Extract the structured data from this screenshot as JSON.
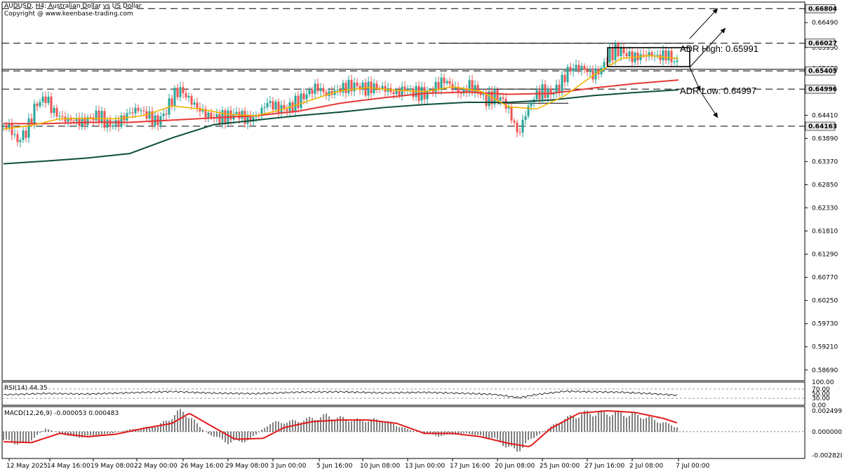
{
  "header": {
    "symbol_line": "AUDUSD, H4:  Australian Dollar vs US Dollar",
    "copyright": "Copyright @ www.keenbase-trading.com"
  },
  "colors": {
    "bull": "#26a69a",
    "bear": "#ef5350",
    "ma_fast": "#f4b400",
    "ma_mid": "#e53935",
    "ma_slow": "#0d4f3c",
    "macd_signal": "#e31b1b",
    "level_tag": "#e8e8e8"
  },
  "chart_data": [
    {
      "type": "candlestick",
      "title": "AUDUSD, H4",
      "ylim": [
        0.5845,
        0.6695
      ],
      "y_ticks": [
        "0.66490",
        "0.65930",
        "0.65460",
        "0.64410",
        "0.63890",
        "0.63370",
        "0.62850",
        "0.62330",
        "0.61810",
        "0.61290",
        "0.60770",
        "0.60250",
        "0.59730",
        "0.59210",
        "0.58690"
      ],
      "x_ticks": [
        "12 May 2025",
        "14 May 16:00",
        "19 May 08:00",
        "22 May 00:00",
        "26 May 16:00",
        "29 May 08:00",
        "3 Jun 00:00",
        "5 Jun 16:00",
        "10 Jun 08:00",
        "13 Jun 00:00",
        "17 Jun 16:00",
        "20 Jun 08:00",
        "25 Jun 00:00",
        "27 Jun 16:00",
        "2 Jul 08:00",
        "7 Jul 00:00"
      ],
      "levels": [
        {
          "value": 0.66804,
          "label": "0.66804",
          "highlight": true
        },
        {
          "value": 0.66027,
          "label": "0.66027",
          "highlight": true
        },
        {
          "value": 0.65405,
          "label": "0.65405",
          "highlight": true
        },
        {
          "value": 0.64996,
          "label": "0.64996",
          "highlight": true
        },
        {
          "value": 0.64163,
          "label": "0.64163",
          "highlight": true
        }
      ],
      "annotations": {
        "adr_high": "ADR High: 0.65991",
        "adr_low": "ADR Low: 0.64997"
      },
      "price_path": [
        [
          0,
          0.6418
        ],
        [
          8,
          0.6415
        ],
        [
          20,
          0.6382
        ],
        [
          34,
          0.6408
        ],
        [
          46,
          0.6465
        ],
        [
          60,
          0.648
        ],
        [
          72,
          0.6448
        ],
        [
          86,
          0.6432
        ],
        [
          100,
          0.643
        ],
        [
          112,
          0.6425
        ],
        [
          124,
          0.6435
        ],
        [
          136,
          0.644
        ],
        [
          150,
          0.6418
        ],
        [
          164,
          0.6425
        ],
        [
          178,
          0.6445
        ],
        [
          192,
          0.6455
        ],
        [
          206,
          0.644
        ],
        [
          218,
          0.6425
        ],
        [
          230,
          0.6445
        ],
        [
          242,
          0.6485
        ],
        [
          252,
          0.6498
        ],
        [
          264,
          0.6478
        ],
        [
          278,
          0.6455
        ],
        [
          292,
          0.644
        ],
        [
          306,
          0.6435
        ],
        [
          320,
          0.6438
        ],
        [
          334,
          0.6445
        ],
        [
          348,
          0.643
        ],
        [
          362,
          0.644
        ],
        [
          376,
          0.647
        ],
        [
          390,
          0.6458
        ],
        [
          404,
          0.6455
        ],
        [
          418,
          0.647
        ],
        [
          432,
          0.6488
        ],
        [
          446,
          0.6505
        ],
        [
          460,
          0.6488
        ],
        [
          474,
          0.6495
        ],
        [
          488,
          0.6505
        ],
        [
          502,
          0.6508
        ],
        [
          516,
          0.65
        ],
        [
          530,
          0.6505
        ],
        [
          544,
          0.65
        ],
        [
          558,
          0.649
        ],
        [
          572,
          0.65
        ],
        [
          586,
          0.6492
        ],
        [
          600,
          0.6488
        ],
        [
          614,
          0.6502
        ],
        [
          628,
          0.652
        ],
        [
          640,
          0.6505
        ],
        [
          652,
          0.649
        ],
        [
          664,
          0.6508
        ],
        [
          676,
          0.6495
        ],
        [
          688,
          0.6475
        ],
        [
          700,
          0.6485
        ],
        [
          712,
          0.6475
        ],
        [
          722,
          0.6445
        ],
        [
          734,
          0.6395
        ],
        [
          744,
          0.6445
        ],
        [
          756,
          0.6482
        ],
        [
          768,
          0.6495
        ],
        [
          780,
          0.649
        ],
        [
          792,
          0.6505
        ],
        [
          804,
          0.654
        ],
        [
          816,
          0.655
        ],
        [
          828,
          0.6545
        ],
        [
          840,
          0.653
        ],
        [
          852,
          0.6545
        ],
        [
          862,
          0.6575
        ],
        [
          874,
          0.6588
        ],
        [
          886,
          0.658
        ],
        [
          898,
          0.657
        ],
        [
          910,
          0.6575
        ],
        [
          922,
          0.6578
        ],
        [
          934,
          0.6572
        ],
        [
          946,
          0.6578
        ],
        [
          956,
          0.656
        ],
        [
          962,
          0.6558
        ]
      ],
      "ma_fast": [
        [
          0,
          0.641
        ],
        [
          40,
          0.6418
        ],
        [
          80,
          0.6433
        ],
        [
          120,
          0.6434
        ],
        [
          160,
          0.6433
        ],
        [
          200,
          0.644
        ],
        [
          240,
          0.6462
        ],
        [
          280,
          0.6455
        ],
        [
          320,
          0.6443
        ],
        [
          360,
          0.644
        ],
        [
          400,
          0.6455
        ],
        [
          440,
          0.6476
        ],
        [
          480,
          0.6496
        ],
        [
          520,
          0.6503
        ],
        [
          560,
          0.6497
        ],
        [
          600,
          0.6494
        ],
        [
          640,
          0.6505
        ],
        [
          680,
          0.6495
        ],
        [
          720,
          0.646
        ],
        [
          760,
          0.6455
        ],
        [
          800,
          0.6485
        ],
        [
          840,
          0.653
        ],
        [
          880,
          0.6568
        ],
        [
          920,
          0.6575
        ],
        [
          962,
          0.6568
        ]
      ],
      "ma_mid": [
        [
          0,
          0.6422
        ],
        [
          60,
          0.6422
        ],
        [
          120,
          0.6425
        ],
        [
          180,
          0.6425
        ],
        [
          240,
          0.643
        ],
        [
          300,
          0.6435
        ],
        [
          360,
          0.644
        ],
        [
          420,
          0.645
        ],
        [
          480,
          0.6468
        ],
        [
          540,
          0.648
        ],
        [
          600,
          0.649
        ],
        [
          660,
          0.6493
        ],
        [
          720,
          0.6488
        ],
        [
          780,
          0.649
        ],
        [
          840,
          0.6502
        ],
        [
          900,
          0.6512
        ],
        [
          962,
          0.652
        ]
      ],
      "ma_slow": [
        [
          0,
          0.6332
        ],
        [
          60,
          0.6338
        ],
        [
          120,
          0.6345
        ],
        [
          180,
          0.6355
        ],
        [
          240,
          0.639
        ],
        [
          300,
          0.642
        ],
        [
          360,
          0.643
        ],
        [
          420,
          0.644
        ],
        [
          480,
          0.6448
        ],
        [
          540,
          0.6458
        ],
        [
          600,
          0.6465
        ],
        [
          660,
          0.647
        ],
        [
          720,
          0.647
        ],
        [
          780,
          0.6475
        ],
        [
          840,
          0.6485
        ],
        [
          900,
          0.6492
        ],
        [
          962,
          0.6498
        ]
      ]
    },
    {
      "type": "line",
      "title": "RSI(14) 44.35",
      "ylim": [
        0,
        100
      ],
      "y_ticks": [
        "100.00",
        "70.00",
        "50.00",
        "30.00",
        "0.00"
      ],
      "x": [
        0,
        60,
        120,
        180,
        240,
        300,
        360,
        420,
        480,
        540,
        600,
        660,
        700,
        735,
        760,
        800,
        840,
        880,
        920,
        962
      ],
      "values": [
        45,
        50,
        47,
        52,
        57,
        50,
        48,
        55,
        57,
        53,
        56,
        52,
        48,
        34,
        48,
        62,
        60,
        58,
        52,
        44.35
      ]
    },
    {
      "type": "bar",
      "title": "MACD(12,26,9) -0.000053 0.000483",
      "ylim": [
        -0.0032,
        0.003
      ],
      "y_ticks": [
        "0.002499",
        "0.000000",
        "-0.002828"
      ],
      "histogram": [
        [
          0,
          -0.0012
        ],
        [
          30,
          -0.0018
        ],
        [
          60,
          0.0004
        ],
        [
          100,
          -0.0008
        ],
        [
          140,
          -0.0005
        ],
        [
          180,
          0.0003
        ],
        [
          220,
          0.0008
        ],
        [
          255,
          0.003
        ],
        [
          290,
          -0.0002
        ],
        [
          320,
          -0.0015
        ],
        [
          350,
          -0.0012
        ],
        [
          380,
          0.0012
        ],
        [
          420,
          0.0015
        ],
        [
          460,
          0.0022
        ],
        [
          500,
          0.0016
        ],
        [
          540,
          0.0016
        ],
        [
          580,
          0.0002
        ],
        [
          620,
          -0.0006
        ],
        [
          660,
          -0.0002
        ],
        [
          700,
          -0.001
        ],
        [
          730,
          -0.0028
        ],
        [
          760,
          -0.0005
        ],
        [
          800,
          0.0018
        ],
        [
          830,
          0.0026
        ],
        [
          870,
          0.0026
        ],
        [
          910,
          0.0022
        ],
        [
          962,
          0.0006
        ]
      ],
      "signal": [
        [
          0,
          -0.0012
        ],
        [
          40,
          -0.0013
        ],
        [
          80,
          -0.0002
        ],
        [
          120,
          -0.0006
        ],
        [
          160,
          -0.0003
        ],
        [
          200,
          0.0004
        ],
        [
          240,
          0.001
        ],
        [
          265,
          0.0022
        ],
        [
          300,
          0.0005
        ],
        [
          330,
          -0.0009
        ],
        [
          370,
          -0.0008
        ],
        [
          400,
          0.0005
        ],
        [
          440,
          0.0012
        ],
        [
          480,
          0.0014
        ],
        [
          520,
          0.0014
        ],
        [
          560,
          0.001
        ],
        [
          600,
          -0.0002
        ],
        [
          640,
          -0.0002
        ],
        [
          680,
          -0.0006
        ],
        [
          720,
          -0.0014
        ],
        [
          750,
          -0.0018
        ],
        [
          780,
          0.0004
        ],
        [
          820,
          0.0022
        ],
        [
          860,
          0.0025
        ],
        [
          900,
          0.0023
        ],
        [
          940,
          0.0016
        ],
        [
          962,
          0.001
        ]
      ]
    }
  ]
}
